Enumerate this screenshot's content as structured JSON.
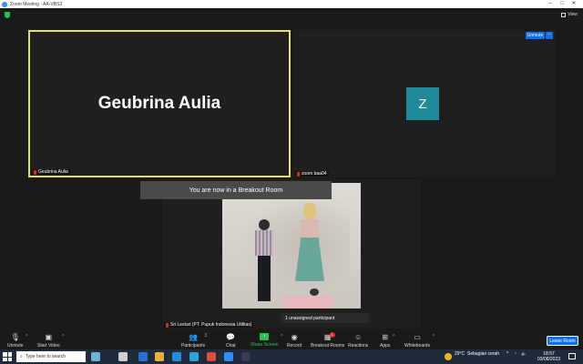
{
  "window": {
    "title": "Zoom Meeting - AA-VBS3"
  },
  "top": {
    "view_label": "View"
  },
  "tiles": {
    "geubrina": {
      "big_name": "Geubrina Aulia",
      "name_label": "Geubrina Aulia"
    },
    "zoom": {
      "avatar_letter": "Z",
      "name_label": "zoom baa04",
      "unmute_label": "Unmute",
      "more_label": "···"
    },
    "sri": {
      "name_label": "Sri Lestari (PT. Pupuk Indonesia Utilitas)"
    }
  },
  "notice": {
    "breakout_text": "You are now in a Breakout Room"
  },
  "unassigned": {
    "text": "1 unassigned participant"
  },
  "toolbar": {
    "unmute": "Unmute",
    "start_video": "Start Video",
    "participants": "Participants",
    "participants_count": "3",
    "chat": "Chat",
    "share_screen": "Share Screen",
    "record": "Record",
    "breakout_rooms": "Breakout Rooms",
    "breakout_badge": "1",
    "reactions": "Reactions",
    "apps": "Apps",
    "whiteboards": "Whiteboards",
    "leave_room": "Leave Room"
  },
  "taskbar": {
    "search_placeholder": "Type here to search",
    "temperature": "29°C",
    "weather": "Sebagian cerah",
    "time": "18:57",
    "date": "03/08/2023"
  }
}
